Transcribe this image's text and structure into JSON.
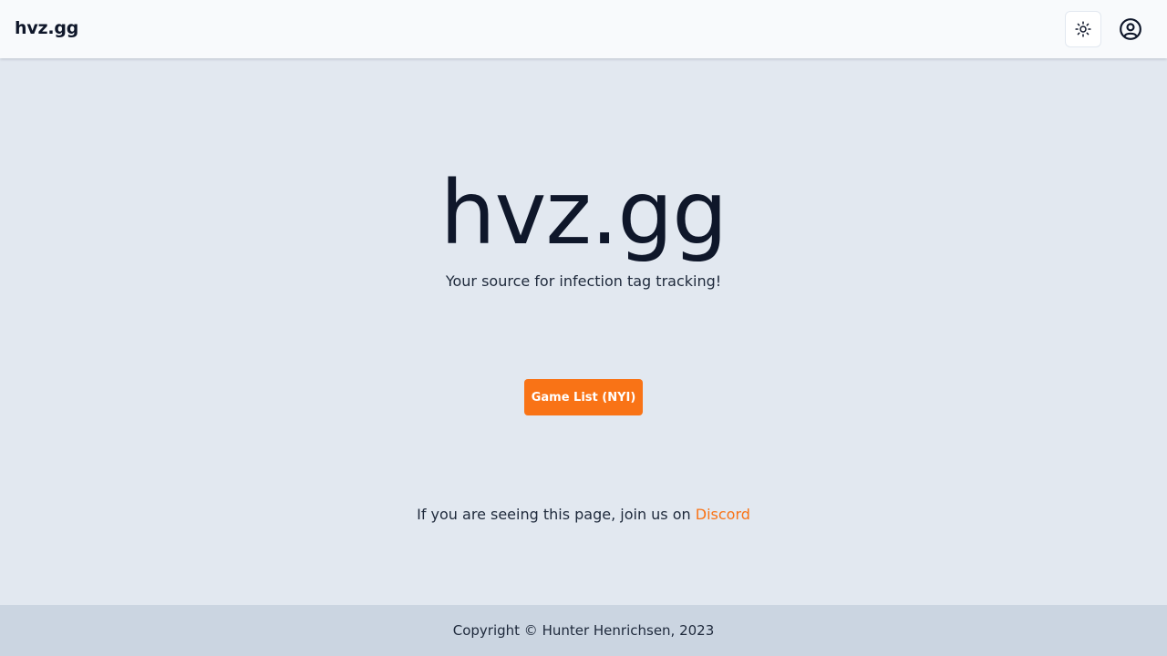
{
  "header": {
    "brand": "hvz.gg",
    "theme_toggle_icon": "sun-icon",
    "account_icon": "user-circle-icon"
  },
  "hero": {
    "title": "hvz.gg",
    "subtitle": "Your source for infection tag tracking!"
  },
  "cta": {
    "label": "Game List (NYI)"
  },
  "community": {
    "text": "If you are seeing this page, join us on ",
    "link_label": "Discord"
  },
  "footer": {
    "copyright": "Copyright © Hunter Henrichsen, 2023"
  },
  "colors": {
    "accent": "#f97316",
    "page_background": "#e2e8f0",
    "header_background": "#f8fafc",
    "footer_background": "#cbd5e1",
    "text_primary": "#0f172a"
  }
}
